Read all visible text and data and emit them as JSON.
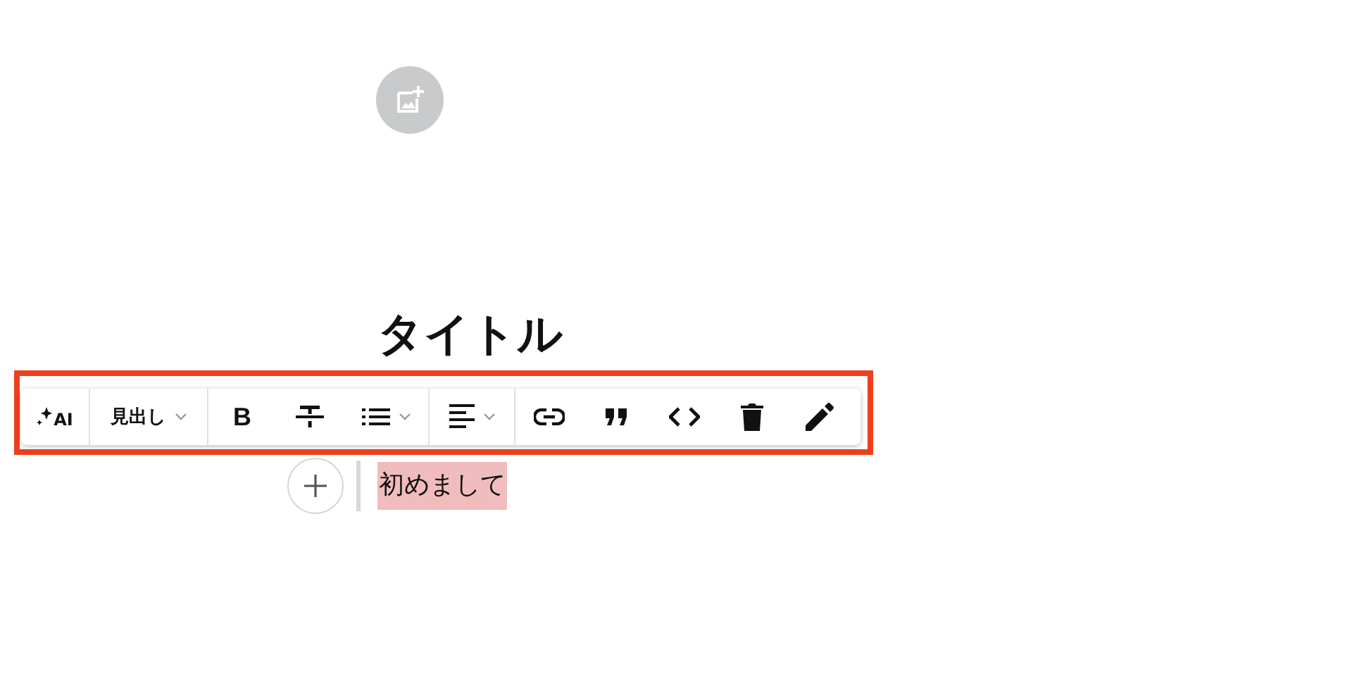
{
  "editor": {
    "title": "タイトル",
    "paragraph": {
      "text": "初めまして",
      "highlighted": true
    }
  },
  "toolbar": {
    "highlighted": true,
    "groups": [
      {
        "items": [
          {
            "kind": "ai",
            "label": "AI",
            "has_menu": false
          }
        ]
      },
      {
        "items": [
          {
            "kind": "heading",
            "label": "見出し",
            "has_menu": true
          }
        ]
      },
      {
        "items": [
          {
            "kind": "bold",
            "label": "B",
            "has_menu": false
          },
          {
            "kind": "strikethrough",
            "has_menu": false
          },
          {
            "kind": "list",
            "has_menu": true
          }
        ]
      },
      {
        "items": [
          {
            "kind": "align",
            "has_menu": true
          }
        ]
      },
      {
        "items": [
          {
            "kind": "link",
            "has_menu": false
          },
          {
            "kind": "quote",
            "has_menu": false
          },
          {
            "kind": "code",
            "has_menu": false
          },
          {
            "kind": "delete",
            "has_menu": false
          },
          {
            "kind": "edit",
            "has_menu": false
          }
        ]
      }
    ]
  }
}
